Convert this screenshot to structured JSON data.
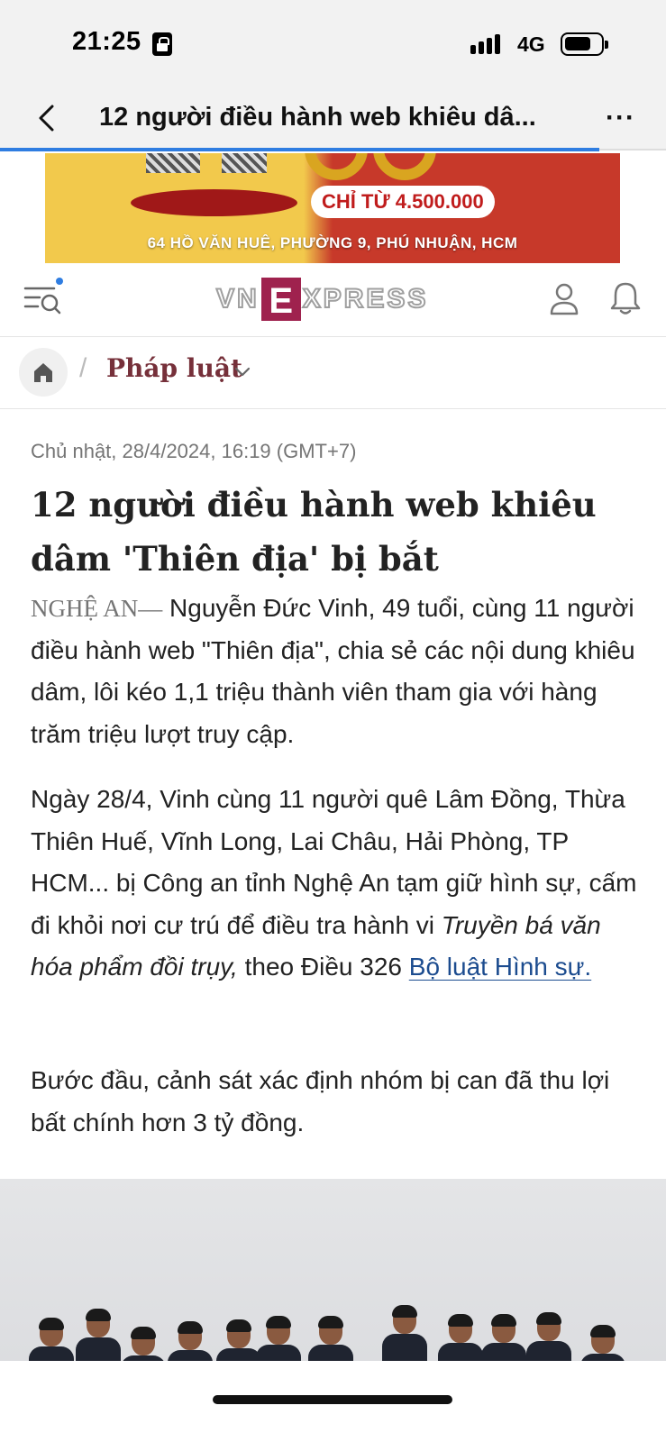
{
  "status_bar": {
    "time": "21:25",
    "network": "4G"
  },
  "nav": {
    "title": "12 người điều hành web khiêu dâ...",
    "more_label": "···",
    "progress_fraction": 0.9
  },
  "ad": {
    "price_text": "CHỈ TỪ 4.500.000",
    "address": "64 HỒ VĂN HUÊ, PHƯỜNG 9, PHÚ NHUẬN, HCM"
  },
  "site_header": {
    "logo_left": "VN",
    "logo_mid": "E",
    "logo_right": "XPRESS"
  },
  "breadcrumb": {
    "separator": "/",
    "category": "Pháp luật"
  },
  "article": {
    "date": "Chủ nhật, 28/4/2024, 16:19 (GMT+7)",
    "title": "12 người điều hành web khiêu dâm 'Thiên địa' bị bắt",
    "lead_location": "NGHỆ AN",
    "lead_dash": "—",
    "lead_text": " Nguyễn Đức Vinh, 49 tuổi, cùng 11 người điều hành web \"Thiên địa\", chia sẻ các nội dung khiêu dâm, lôi kéo 1,1 triệu thành viên tham gia với hàng trăm triệu lượt truy cập.",
    "p2_text_a": "Ngày 28/4, Vinh cùng 11 người quê Lâm Đồng, Thừa Thiên Huế, Vĩnh Long, Lai Châu, Hải Phòng, TP HCM... bị Công an tỉnh Nghệ An tạm giữ hình sự, cấm đi khỏi nơi cư trú để điều tra hành vi ",
    "p2_italic": "Truyền bá văn hóa phẩm đồi trụy,",
    "p2_text_b": " theo Điều 326 ",
    "p2_link": "Bộ luật Hình sự.",
    "p3_text": "Bước đầu, cảnh sát xác định nhóm bị can đã thu lợi bất chính hơn 3 tỷ đồng."
  },
  "colors": {
    "accent_blue": "#2f7de1",
    "brand": "#9f224e",
    "category": "#76303a",
    "link": "#1c4c8f"
  }
}
